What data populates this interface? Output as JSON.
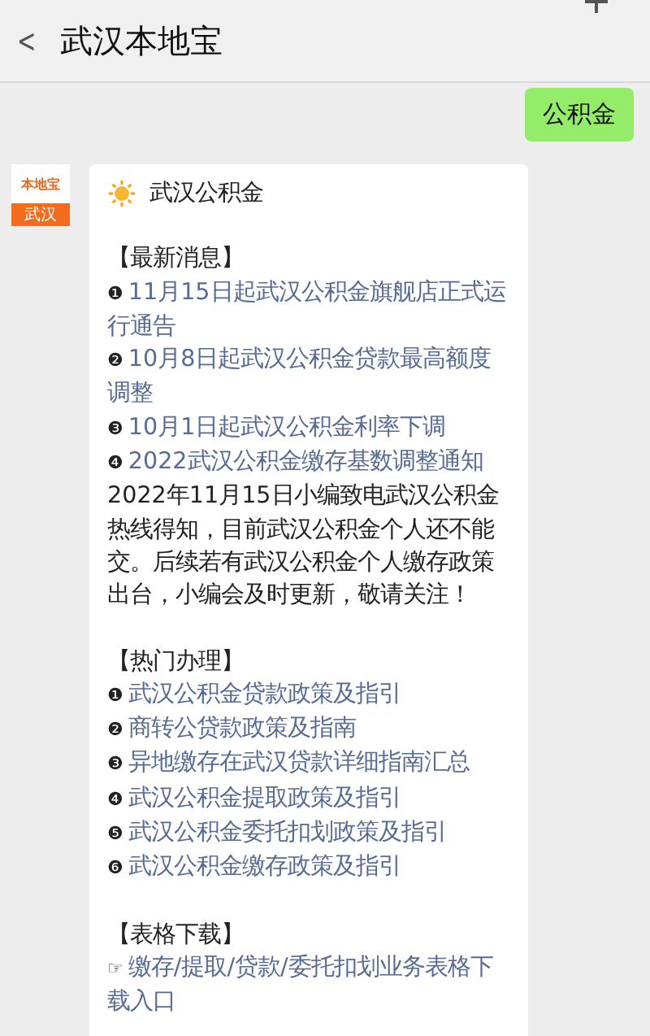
{
  "header": {
    "back": "<",
    "title": "武汉本地宝"
  },
  "messages": [
    {
      "kind": "sent",
      "text": "公积金"
    }
  ],
  "card": {
    "avatar": {
      "brand": "本地宝",
      "city": "武汉"
    },
    "title": "武汉公积金",
    "sections": [
      {
        "kind": "links",
        "heading": "【最新消息】",
        "items": [
          {
            "bullet": "❶",
            "text": "11月15日起武汉公积金旗舰店正式运行通告"
          },
          {
            "bullet": "❷",
            "text": "10月8日起武汉公积金贷款最高额度调整"
          },
          {
            "bullet": "❸",
            "text": "10月1日起武汉公积金利率下调"
          },
          {
            "bullet": "❹",
            "text": "2022武汉公积金缴存基数调整通知"
          }
        ],
        "note": "2022年11月15日小编致电武汉公积金热线得知，目前武汉公积金个人还不能交。后续若有武汉公积金个人缴存政策出台，小编会及时更新，敬请关注！"
      },
      {
        "kind": "links",
        "heading": "【热门办理】",
        "items": [
          {
            "bullet": "❶",
            "text": "武汉公积金贷款政策及指引"
          },
          {
            "bullet": "❷",
            "text": "商转公贷款政策及指南"
          },
          {
            "bullet": "❸",
            "text": "异地缴存在武汉贷款详细指南汇总"
          },
          {
            "bullet": "❹",
            "text": "武汉公积金提取政策及指引"
          },
          {
            "bullet": "❺",
            "text": "武汉公积金委托扣划政策及指引"
          },
          {
            "bullet": "❻",
            "text": "武汉公积金缴存政策及指引"
          }
        ]
      },
      {
        "kind": "links",
        "heading": "【表格下载】",
        "items": [
          {
            "bullet": "☞",
            "text": "缴存/提取/贷款/委托扣划业务表格下载入口"
          }
        ]
      }
    ]
  }
}
